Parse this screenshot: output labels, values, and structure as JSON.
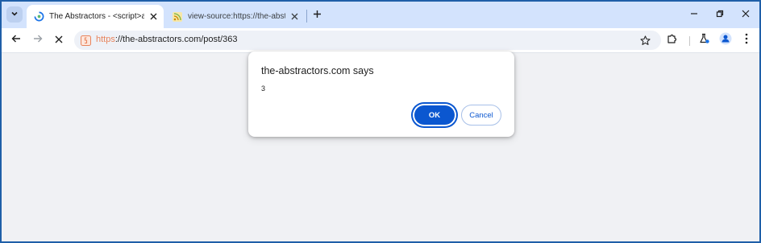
{
  "tabs": [
    {
      "title": "The Abstractors - <script>alert(",
      "active": true,
      "favicon": "loading-spinner-icon"
    },
    {
      "title": "view-source:https://the-abstrac",
      "active": false,
      "favicon": "rss-feed-icon"
    }
  ],
  "address_bar": {
    "protocol": "https",
    "rest": "://the-abstractors.com/post/363"
  },
  "dialog": {
    "title": "the-abstractors.com says",
    "message": "3",
    "ok_label": "OK",
    "cancel_label": "Cancel"
  },
  "colors": {
    "tabstrip": "#d3e3fd",
    "accent": "#0b57d0",
    "protocol": "#e8845c",
    "page_background": "#f0f1f4"
  }
}
